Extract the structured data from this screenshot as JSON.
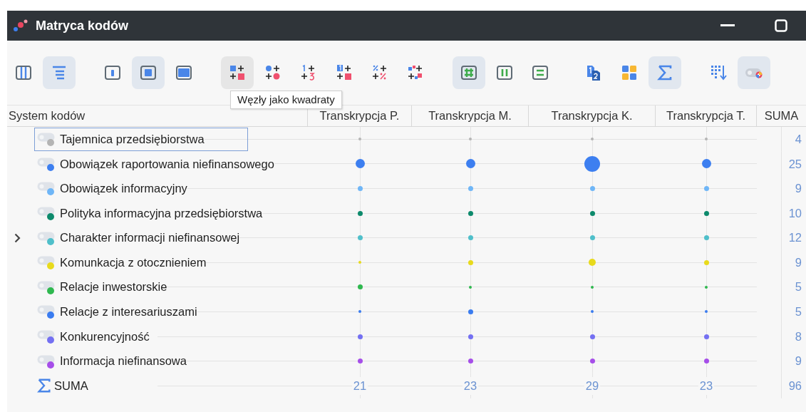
{
  "window": {
    "title": "Matryca kodów"
  },
  "toolbar_groups": [
    {
      "buttons": [
        {
          "selected": false,
          "hovered": false
        },
        {
          "selected": true,
          "hovered": false
        }
      ]
    },
    {
      "buttons": [
        {
          "selected": false,
          "hovered": false
        },
        {
          "selected": true,
          "hovered": false
        },
        {
          "selected": false,
          "hovered": false
        }
      ]
    },
    {
      "buttons": [
        {
          "selected": false,
          "hovered": true
        },
        {
          "selected": false,
          "hovered": false
        },
        {
          "selected": false,
          "hovered": false
        },
        {
          "selected": false,
          "hovered": false
        },
        {
          "selected": false,
          "hovered": false
        },
        {
          "selected": false,
          "hovered": false
        }
      ]
    },
    {
      "buttons": [
        {
          "selected": true,
          "hovered": false
        },
        {
          "selected": false,
          "hovered": false
        },
        {
          "selected": false,
          "hovered": false
        }
      ]
    },
    {
      "buttons": [
        {
          "selected": false,
          "hovered": false
        },
        {
          "selected": false,
          "hovered": false
        },
        {
          "selected": true,
          "hovered": false
        }
      ]
    },
    {
      "buttons": [
        {
          "selected": false,
          "hovered": false
        },
        {
          "selected": true,
          "hovered": false
        }
      ]
    }
  ],
  "tooltip": "Węzły jako kwadraty",
  "table": {
    "columns": [
      "System kodów",
      "Transkrypcja P.",
      "Transkrypcja M.",
      "Transkrypcja K.",
      "Transkrypcja T.",
      "SUMA"
    ],
    "rows": [
      {
        "label": "Tajemnica przedsiębiorstwa",
        "color": "#b4b4b4",
        "expandable": false,
        "focused": true,
        "cells": [
          {
            "kind": "tiny"
          },
          {
            "kind": "tiny"
          },
          {
            "kind": "tiny"
          },
          {
            "kind": "tiny"
          }
        ],
        "sum": "4"
      },
      {
        "label": "Obowiązek raportowania niefinansowego",
        "color": "#3d7ff0",
        "expandable": false,
        "focused": false,
        "cells": [
          {
            "kind": "large"
          },
          {
            "kind": "large"
          },
          {
            "kind": "huge"
          },
          {
            "kind": "large"
          }
        ],
        "sum": "25"
      },
      {
        "label": "Obowiązek informacyjny",
        "color": "#6fb6f7",
        "expandable": false,
        "focused": false,
        "cells": [
          {
            "kind": "small"
          },
          {
            "kind": "small"
          },
          {
            "kind": "small"
          },
          {
            "kind": "small"
          }
        ],
        "sum": "9"
      },
      {
        "label": "Polityka informacyjna przedsiębiorstwa",
        "color": "#0d8a6c",
        "expandable": false,
        "focused": false,
        "cells": [
          {
            "kind": "small"
          },
          {
            "kind": "small"
          },
          {
            "kind": "small"
          },
          {
            "kind": "small"
          }
        ],
        "sum": "10"
      },
      {
        "label": "Charakter informacji niefinansowej",
        "color": "#4fbfca",
        "expandable": true,
        "focused": false,
        "cells": [
          {
            "kind": "small"
          },
          {
            "kind": "small"
          },
          {
            "kind": "small"
          },
          {
            "kind": "small"
          }
        ],
        "sum": "12"
      },
      {
        "label": "Komunkacja z otocznieniem",
        "color": "#e8da1c",
        "expandable": false,
        "focused": false,
        "cells": [
          {
            "kind": "tiny"
          },
          {
            "kind": "small"
          },
          {
            "kind": "medium"
          },
          {
            "kind": "small"
          }
        ],
        "sum": "9"
      },
      {
        "label": "Relacje inwestorskie",
        "color": "#2fb84f",
        "expandable": false,
        "focused": false,
        "cells": [
          {
            "kind": "small"
          },
          {
            "kind": "tiny"
          },
          {
            "kind": "tiny"
          },
          {
            "kind": "tiny"
          }
        ],
        "sum": "5"
      },
      {
        "label": "Relacje z interesariuszami",
        "color": "#3a7cf0",
        "expandable": false,
        "focused": false,
        "cells": [
          {
            "kind": "tiny"
          },
          {
            "kind": "small"
          },
          {
            "kind": "tiny"
          },
          {
            "kind": "tiny"
          }
        ],
        "sum": "5"
      },
      {
        "label": "Konkurencyjność",
        "color": "#7470f2",
        "expandable": false,
        "focused": false,
        "cells": [
          {
            "kind": "small"
          },
          {
            "kind": "small"
          },
          {
            "kind": "small"
          },
          {
            "kind": "small"
          }
        ],
        "sum": "8"
      },
      {
        "label": "Informacja niefinansowa",
        "color": "#a64ee9",
        "expandable": false,
        "focused": false,
        "cells": [
          {
            "kind": "small"
          },
          {
            "kind": "small"
          },
          {
            "kind": "small"
          },
          {
            "kind": "small"
          }
        ],
        "sum": "9"
      }
    ],
    "sum_row": {
      "label": "SUMA",
      "values": [
        "21",
        "23",
        "29",
        "23"
      ],
      "total": "96"
    }
  }
}
